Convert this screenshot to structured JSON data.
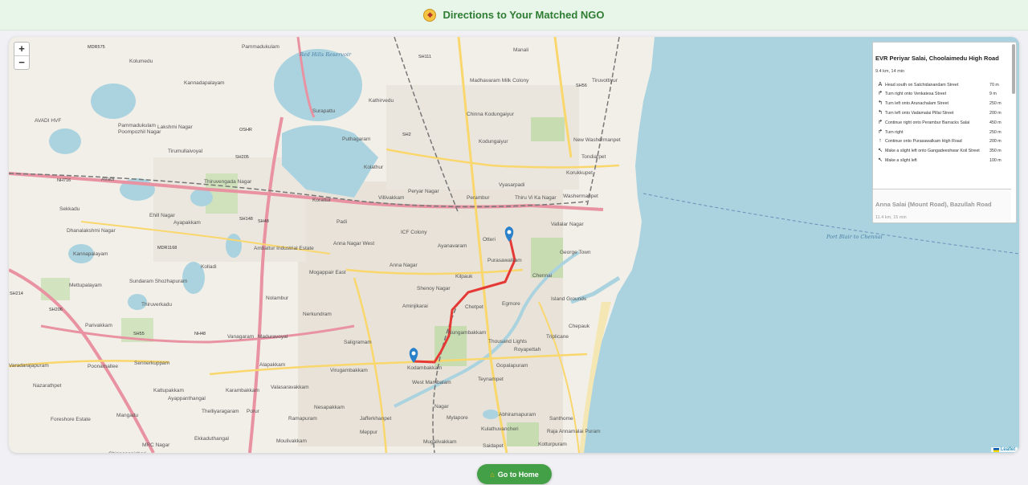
{
  "header": {
    "title": "Directions to Your Matched NGO",
    "icon": "compass-icon"
  },
  "map": {
    "zoom_in": "+",
    "zoom_out": "−",
    "attribution": "Leaflet",
    "water_labels": [
      "Red Hills Reservoir",
      "Port Blair to Chennai"
    ],
    "road_labels": [
      "NH716",
      "SH111",
      "SH56",
      "SH2",
      "SH205",
      "SH48",
      "MDR1168",
      "MDR575",
      "OSHR",
      "SH148",
      "SH214",
      "SH206",
      "SH55",
      "NH48"
    ],
    "places": [
      "Pammadukulam",
      "Kolumedu",
      "Kannadapalayam",
      "Surapattu",
      "Kathirvedu",
      "Chinna Kodungaiyur",
      "Madhavaram Milk Colony",
      "Manali",
      "Tiruvottiyur",
      "Pammadukulam",
      "Poompozhil Nagar",
      "Lakshmi Nagar",
      "Puthagaram",
      "Kodungaiyur",
      "New Washermanpet",
      "Tondiarpet",
      "AVADI HVF",
      "Avadi",
      "Tirumullaivoyal",
      "Thiruvengada Nagar",
      "Kolathur",
      "Peryar Nagar",
      "Perambur",
      "Vyasarpadi",
      "Korukkupet",
      "Sekkadu",
      "Korattur",
      "Villivakkam",
      "Thiru Vi Ka Nagar",
      "Washermanpet",
      "Ayapakkam",
      "Ehill Nagar",
      "Padi",
      "ICF Colony",
      "Vallalar Nagar",
      "Dhanalakshmi Nagar",
      "Ambattur Industrial Estate",
      "Anna Nagar West",
      "Ayanavaram",
      "Otteri",
      "George Town",
      "Kannapalayam",
      "Kolladi",
      "Anna Nagar",
      "Purasawalkam",
      "Chennai",
      "Mettupalayam",
      "Sundaram Shozhapuram",
      "Mogappair East",
      "Kilpauk",
      "Shenoy Nagar",
      "Chetpet",
      "Egmore",
      "Island Grounds",
      "Thiruverkadu",
      "Nolambur",
      "Nerkundram",
      "Aminjikarai",
      "Chepauk",
      "Parivakkam",
      "Vanagaram",
      "Maduravoyal",
      "Nungambakkam",
      "Thousand Lights",
      "Triplicane",
      "Saligramam",
      "Royapettah",
      "Alapakkam",
      "Virugambakkam",
      "Kodambakkam",
      "Gopalapuram",
      "Varadarajapuram",
      "Poonamallee",
      "Sennerkuppam",
      "West Mambalam",
      "Teynampet",
      "Nazarathpet",
      "Kattupakkam",
      "Karambakkam",
      "Valasaravakkam",
      "Ayappanthangal",
      "Nesapakkam",
      "Nagar",
      "Mylapore",
      "Thelliyaragaram",
      "Porur",
      "Ramapuram",
      "Jafferkhanpet",
      "Abhiramapuram",
      "Santhome",
      "Mangadu",
      "Kulathuvancheri",
      "Raja Annamalai Puram",
      "Foreshore Estate",
      "Meppur",
      "Ekkaduthangal",
      "Moulivakkam",
      "Mugalivakkam",
      "Saidapet",
      "Kotturpuram",
      "MRC Nagar",
      "Chinnapanicheri",
      "Chikkarayapuram"
    ]
  },
  "directions": {
    "route_title": "EVR Periyar Salai, Choolaimedu High Road",
    "route_summary": "9.4 km, 14 min",
    "steps": [
      {
        "icon": "head-south-icon",
        "glyph": "A",
        "text": "Head south on Satchidanandam Street",
        "distance": "70 m"
      },
      {
        "icon": "turn-right-icon",
        "glyph": "↱",
        "text": "Turn right onto Venkatesa Street",
        "distance": "9 m"
      },
      {
        "icon": "turn-left-icon",
        "glyph": "↰",
        "text": "Turn left onto Arunachalam Street",
        "distance": "250 m"
      },
      {
        "icon": "turn-left-icon",
        "glyph": "↰",
        "text": "Turn left onto Vadamalai Pillai Street",
        "distance": "200 m"
      },
      {
        "icon": "turn-right-icon",
        "glyph": "↱",
        "text": "Continue right onto Perambur Barracks Salai",
        "distance": "450 m"
      },
      {
        "icon": "turn-right-icon",
        "glyph": "↱",
        "text": "Turn right",
        "distance": "250 m"
      },
      {
        "icon": "straight-icon",
        "glyph": "↑",
        "text": "Continue onto Purasawalkam High Road",
        "distance": "200 m"
      },
      {
        "icon": "slight-left-icon",
        "glyph": "↖",
        "text": "Make a slight left onto Gangadeeshwar Koil Street",
        "distance": "350 m"
      },
      {
        "icon": "slight-left-icon",
        "glyph": "↖",
        "text": "Make a slight left",
        "distance": "100 m"
      }
    ],
    "alt_title": "Anna Salai (Mount Road), Bazullah Road",
    "alt_summary": "11.4 km, 15 min"
  },
  "footer": {
    "home_label": "Go to Home",
    "home_icon": "house-icon"
  },
  "colors": {
    "accent": "#43a047",
    "title": "#2e7d32",
    "route": "#e53935",
    "marker": "#2a81cb",
    "water": "#aad3df",
    "land": "#f2efe9"
  }
}
